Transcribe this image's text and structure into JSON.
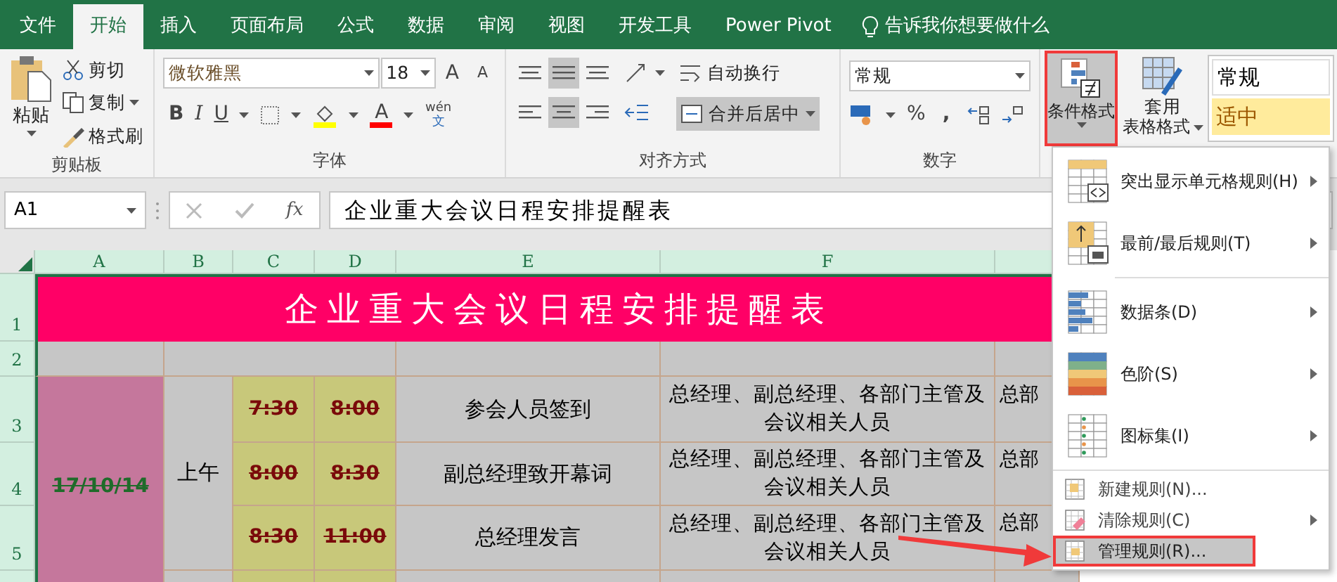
{
  "tabs": [
    {
      "label": "文件",
      "selected": false
    },
    {
      "label": "开始",
      "selected": true
    },
    {
      "label": "插入",
      "selected": false
    },
    {
      "label": "页面布局",
      "selected": false
    },
    {
      "label": "公式",
      "selected": false
    },
    {
      "label": "数据",
      "selected": false
    },
    {
      "label": "审阅",
      "selected": false
    },
    {
      "label": "视图",
      "selected": false
    },
    {
      "label": "开发工具",
      "selected": false
    },
    {
      "label": "Power Pivot",
      "selected": false
    }
  ],
  "tell_me": "告诉我你想要做什么",
  "ribbon": {
    "clipboard": {
      "paste": "粘贴",
      "cut": "剪切",
      "copy": "复制",
      "format_painter": "格式刷",
      "label": "剪贴板"
    },
    "font": {
      "name": "微软雅黑",
      "size": "18",
      "grow": "A",
      "shrink": "A",
      "bold": "B",
      "italic": "I",
      "underline": "U",
      "font_color": "A",
      "phonetic_top": "wén",
      "phonetic_bottom": "文",
      "label": "字体"
    },
    "alignment": {
      "wrap": "自动换行",
      "merge": "合并后居中",
      "label": "对齐方式",
      "vertical": [
        {
          "selected": false
        },
        {
          "selected": true
        },
        {
          "selected": false
        }
      ],
      "horizontal": [
        {
          "selected": false
        },
        {
          "selected": true
        },
        {
          "selected": false
        }
      ]
    },
    "number": {
      "format": "常规",
      "percent": "%",
      "comma": ",",
      "label": "数字"
    },
    "conditional_format": {
      "label": "条件格式",
      "selected": true,
      "highlighted": true
    },
    "table_format": {
      "line1": "套用",
      "line2": "表格格式"
    },
    "styles": [
      {
        "label": "常规",
        "kind": "normal"
      },
      {
        "label": "适中",
        "kind": "neutral"
      }
    ]
  },
  "formula_bar": {
    "cell": "A1",
    "fx": "fx",
    "value": "企业重大会议日程安排提醒表"
  },
  "sheet": {
    "columns": [
      "A",
      "B",
      "C",
      "D",
      "E",
      "F"
    ],
    "row_numbers": [
      "1",
      "2",
      "3",
      "4",
      "5"
    ],
    "title": "企业重大会议日程安排提醒表",
    "date": "17/10/14",
    "date_struck": true,
    "period": "上午",
    "rows": [
      {
        "start": "7:30",
        "end": "8:00",
        "event": "参会人员签到",
        "attendees": "总经理、副总经理、各部门主管及会议相关人员",
        "place": "总部",
        "struck": true
      },
      {
        "start": "8:00",
        "end": "8:30",
        "event": "副总经理致开幕词",
        "attendees": "总经理、副总经理、各部门主管及会议相关人员",
        "place": "总部",
        "struck": true
      },
      {
        "start": "8:30",
        "end": "11:00",
        "event": "总经理发言",
        "attendees": "总经理、副总经理、各部门主管及会议相关人员",
        "place": "总部",
        "struck": true
      }
    ]
  },
  "menu": [
    {
      "label": "突出显示单元格规则(H)",
      "kind": "large",
      "submenu": true,
      "separator_before": false,
      "selected": false,
      "highlighted": false
    },
    {
      "label": "最前/最后规则(T)",
      "kind": "large",
      "submenu": true,
      "separator_before": false,
      "selected": false,
      "highlighted": false
    },
    {
      "label": "数据条(D)",
      "kind": "large",
      "submenu": true,
      "separator_before": true,
      "selected": false,
      "highlighted": false
    },
    {
      "label": "色阶(S)",
      "kind": "large",
      "submenu": true,
      "separator_before": false,
      "selected": false,
      "highlighted": false
    },
    {
      "label": "图标集(I)",
      "kind": "large",
      "submenu": true,
      "separator_before": false,
      "selected": false,
      "highlighted": false
    },
    {
      "label": "新建规则(N)...",
      "kind": "small",
      "submenu": false,
      "separator_before": true,
      "selected": false,
      "highlighted": false
    },
    {
      "label": "清除规则(C)",
      "kind": "small",
      "submenu": true,
      "separator_before": false,
      "selected": false,
      "highlighted": false
    },
    {
      "label": "管理规则(R)...",
      "kind": "small",
      "submenu": false,
      "separator_before": false,
      "selected": true,
      "highlighted": true
    }
  ]
}
